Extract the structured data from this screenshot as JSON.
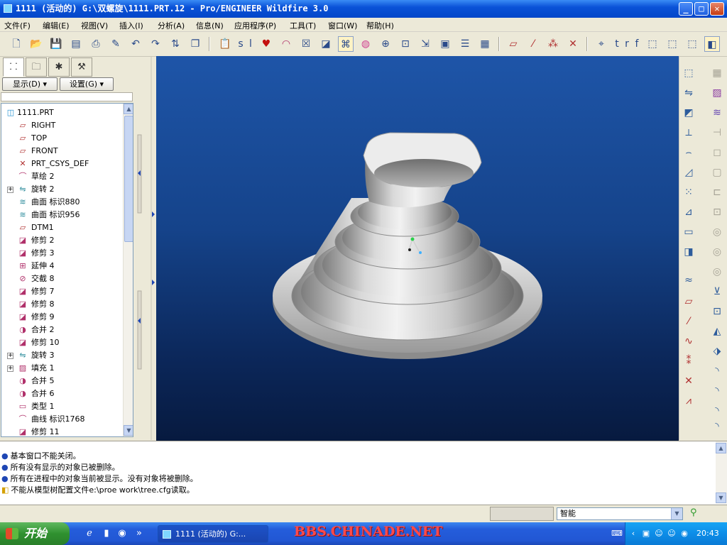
{
  "window": {
    "title": "1111 (活动的) G:\\双螺旋\\1111.PRT.12 - Pro/ENGINEER Wildfire 3.0",
    "minimize": "_",
    "maximize": "□",
    "close": "✕"
  },
  "menu": [
    {
      "label": "文件(F)"
    },
    {
      "label": "编辑(E)"
    },
    {
      "label": "视图(V)"
    },
    {
      "label": "插入(I)"
    },
    {
      "label": "分析(A)"
    },
    {
      "label": "信息(N)"
    },
    {
      "label": "应用程序(P)"
    },
    {
      "label": "工具(T)"
    },
    {
      "label": "窗口(W)"
    },
    {
      "label": "帮助(H)"
    }
  ],
  "toolbar": {
    "text_s": "s",
    "text_l": "l",
    "text_t": "t",
    "text_r": "r",
    "text_f": "f"
  },
  "navigator": {
    "show_btn": "显示(D) ▾",
    "settings_btn": "设置(G) ▾"
  },
  "tree": [
    {
      "label": "1111.PRT",
      "icon": "part-icon",
      "expandable": false
    },
    {
      "label": "RIGHT",
      "icon": "datum-plane-icon",
      "expandable": false
    },
    {
      "label": "TOP",
      "icon": "datum-plane-icon",
      "expandable": false
    },
    {
      "label": "FRONT",
      "icon": "datum-plane-icon",
      "expandable": false
    },
    {
      "label": "PRT_CSYS_DEF",
      "icon": "csys-icon",
      "expandable": false
    },
    {
      "label": "草绘 2",
      "icon": "sketch-icon",
      "expandable": false
    },
    {
      "label": "旋转 2",
      "icon": "revolve-icon",
      "expandable": true
    },
    {
      "label": "曲面 标识880",
      "icon": "surface-icon",
      "expandable": false
    },
    {
      "label": "曲面 标识956",
      "icon": "surface-icon",
      "expandable": false
    },
    {
      "label": "DTM1",
      "icon": "datum-plane-icon",
      "expandable": false
    },
    {
      "label": "修剪 2",
      "icon": "trim-icon",
      "expandable": false
    },
    {
      "label": "修剪 3",
      "icon": "trim-icon",
      "expandable": false
    },
    {
      "label": "延伸 4",
      "icon": "extend-icon",
      "expandable": false
    },
    {
      "label": "交截 8",
      "icon": "intersect-icon",
      "expandable": false
    },
    {
      "label": "修剪 7",
      "icon": "trim-icon",
      "expandable": false
    },
    {
      "label": "修剪 8",
      "icon": "trim-icon",
      "expandable": false
    },
    {
      "label": "修剪 9",
      "icon": "trim-icon",
      "expandable": false
    },
    {
      "label": "合并 2",
      "icon": "merge-icon",
      "expandable": false
    },
    {
      "label": "修剪 10",
      "icon": "trim-icon",
      "expandable": false
    },
    {
      "label": "旋转 3",
      "icon": "revolve-icon",
      "expandable": true
    },
    {
      "label": "填充 1",
      "icon": "fill-icon",
      "expandable": true
    },
    {
      "label": "合并 5",
      "icon": "merge-icon",
      "expandable": false
    },
    {
      "label": "合并 6",
      "icon": "merge-icon",
      "expandable": false
    },
    {
      "label": "类型 1",
      "icon": "type-icon",
      "expandable": false
    },
    {
      "label": "曲线 标识1768",
      "icon": "curve-icon",
      "expandable": false
    },
    {
      "label": "修剪 11",
      "icon": "trim-icon",
      "expandable": false
    }
  ],
  "messages": [
    {
      "text": "基本窗口不能关闭。"
    },
    {
      "text": "所有没有显示的对象已被删除。"
    },
    {
      "text": "所有在进程中的对象当前被显示。没有对象将被删除。"
    },
    {
      "text": "不能从模型树配置文件e:\\proe work\\tree.cfg读取。"
    }
  ],
  "status": {
    "filter_value": "智能"
  },
  "taskbar": {
    "start": "开始",
    "task_item": "1111 (活动的) G:...",
    "watermark": "BBS.CHINADE.NET",
    "clock": "20:43"
  },
  "colors": {
    "viewport_top": "#1e55a8",
    "viewport_bottom": "#071a3f",
    "model": "#d9d9d9"
  }
}
